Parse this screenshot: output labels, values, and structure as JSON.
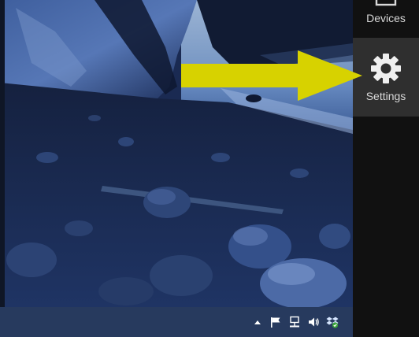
{
  "charms": {
    "devices": {
      "label": "Devices",
      "icon": "devices-icon"
    },
    "settings": {
      "label": "Settings",
      "icon": "gear-icon"
    }
  },
  "taskbar": {
    "tray_icons": [
      "show-hidden-icons-arrow",
      "action-center-flag-icon",
      "network-icon",
      "volume-icon",
      "dropbox-icon"
    ]
  },
  "annotation": {
    "arrow_color": "#d7d200",
    "icon": "arrow-right-icon"
  },
  "colors": {
    "charms_bg": "#111111",
    "settings_highlight": "#2f2f2f",
    "taskbar_bg": "#273a5e"
  }
}
